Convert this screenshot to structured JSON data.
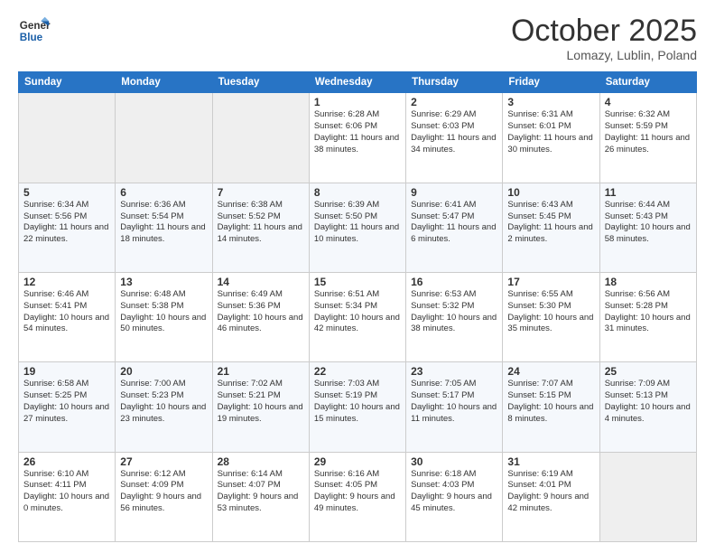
{
  "logo": {
    "line1": "General",
    "line2": "Blue"
  },
  "title": "October 2025",
  "location": "Lomazy, Lublin, Poland",
  "weekdays": [
    "Sunday",
    "Monday",
    "Tuesday",
    "Wednesday",
    "Thursday",
    "Friday",
    "Saturday"
  ],
  "weeks": [
    [
      {
        "day": "",
        "info": ""
      },
      {
        "day": "",
        "info": ""
      },
      {
        "day": "",
        "info": ""
      },
      {
        "day": "1",
        "info": "Sunrise: 6:28 AM\nSunset: 6:06 PM\nDaylight: 11 hours\nand 38 minutes."
      },
      {
        "day": "2",
        "info": "Sunrise: 6:29 AM\nSunset: 6:03 PM\nDaylight: 11 hours\nand 34 minutes."
      },
      {
        "day": "3",
        "info": "Sunrise: 6:31 AM\nSunset: 6:01 PM\nDaylight: 11 hours\nand 30 minutes."
      },
      {
        "day": "4",
        "info": "Sunrise: 6:32 AM\nSunset: 5:59 PM\nDaylight: 11 hours\nand 26 minutes."
      }
    ],
    [
      {
        "day": "5",
        "info": "Sunrise: 6:34 AM\nSunset: 5:56 PM\nDaylight: 11 hours\nand 22 minutes."
      },
      {
        "day": "6",
        "info": "Sunrise: 6:36 AM\nSunset: 5:54 PM\nDaylight: 11 hours\nand 18 minutes."
      },
      {
        "day": "7",
        "info": "Sunrise: 6:38 AM\nSunset: 5:52 PM\nDaylight: 11 hours\nand 14 minutes."
      },
      {
        "day": "8",
        "info": "Sunrise: 6:39 AM\nSunset: 5:50 PM\nDaylight: 11 hours\nand 10 minutes."
      },
      {
        "day": "9",
        "info": "Sunrise: 6:41 AM\nSunset: 5:47 PM\nDaylight: 11 hours\nand 6 minutes."
      },
      {
        "day": "10",
        "info": "Sunrise: 6:43 AM\nSunset: 5:45 PM\nDaylight: 11 hours\nand 2 minutes."
      },
      {
        "day": "11",
        "info": "Sunrise: 6:44 AM\nSunset: 5:43 PM\nDaylight: 10 hours\nand 58 minutes."
      }
    ],
    [
      {
        "day": "12",
        "info": "Sunrise: 6:46 AM\nSunset: 5:41 PM\nDaylight: 10 hours\nand 54 minutes."
      },
      {
        "day": "13",
        "info": "Sunrise: 6:48 AM\nSunset: 5:38 PM\nDaylight: 10 hours\nand 50 minutes."
      },
      {
        "day": "14",
        "info": "Sunrise: 6:49 AM\nSunset: 5:36 PM\nDaylight: 10 hours\nand 46 minutes."
      },
      {
        "day": "15",
        "info": "Sunrise: 6:51 AM\nSunset: 5:34 PM\nDaylight: 10 hours\nand 42 minutes."
      },
      {
        "day": "16",
        "info": "Sunrise: 6:53 AM\nSunset: 5:32 PM\nDaylight: 10 hours\nand 38 minutes."
      },
      {
        "day": "17",
        "info": "Sunrise: 6:55 AM\nSunset: 5:30 PM\nDaylight: 10 hours\nand 35 minutes."
      },
      {
        "day": "18",
        "info": "Sunrise: 6:56 AM\nSunset: 5:28 PM\nDaylight: 10 hours\nand 31 minutes."
      }
    ],
    [
      {
        "day": "19",
        "info": "Sunrise: 6:58 AM\nSunset: 5:25 PM\nDaylight: 10 hours\nand 27 minutes."
      },
      {
        "day": "20",
        "info": "Sunrise: 7:00 AM\nSunset: 5:23 PM\nDaylight: 10 hours\nand 23 minutes."
      },
      {
        "day": "21",
        "info": "Sunrise: 7:02 AM\nSunset: 5:21 PM\nDaylight: 10 hours\nand 19 minutes."
      },
      {
        "day": "22",
        "info": "Sunrise: 7:03 AM\nSunset: 5:19 PM\nDaylight: 10 hours\nand 15 minutes."
      },
      {
        "day": "23",
        "info": "Sunrise: 7:05 AM\nSunset: 5:17 PM\nDaylight: 10 hours\nand 11 minutes."
      },
      {
        "day": "24",
        "info": "Sunrise: 7:07 AM\nSunset: 5:15 PM\nDaylight: 10 hours\nand 8 minutes."
      },
      {
        "day": "25",
        "info": "Sunrise: 7:09 AM\nSunset: 5:13 PM\nDaylight: 10 hours\nand 4 minutes."
      }
    ],
    [
      {
        "day": "26",
        "info": "Sunrise: 6:10 AM\nSunset: 4:11 PM\nDaylight: 10 hours\nand 0 minutes."
      },
      {
        "day": "27",
        "info": "Sunrise: 6:12 AM\nSunset: 4:09 PM\nDaylight: 9 hours\nand 56 minutes."
      },
      {
        "day": "28",
        "info": "Sunrise: 6:14 AM\nSunset: 4:07 PM\nDaylight: 9 hours\nand 53 minutes."
      },
      {
        "day": "29",
        "info": "Sunrise: 6:16 AM\nSunset: 4:05 PM\nDaylight: 9 hours\nand 49 minutes."
      },
      {
        "day": "30",
        "info": "Sunrise: 6:18 AM\nSunset: 4:03 PM\nDaylight: 9 hours\nand 45 minutes."
      },
      {
        "day": "31",
        "info": "Sunrise: 6:19 AM\nSunset: 4:01 PM\nDaylight: 9 hours\nand 42 minutes."
      },
      {
        "day": "",
        "info": ""
      }
    ]
  ]
}
